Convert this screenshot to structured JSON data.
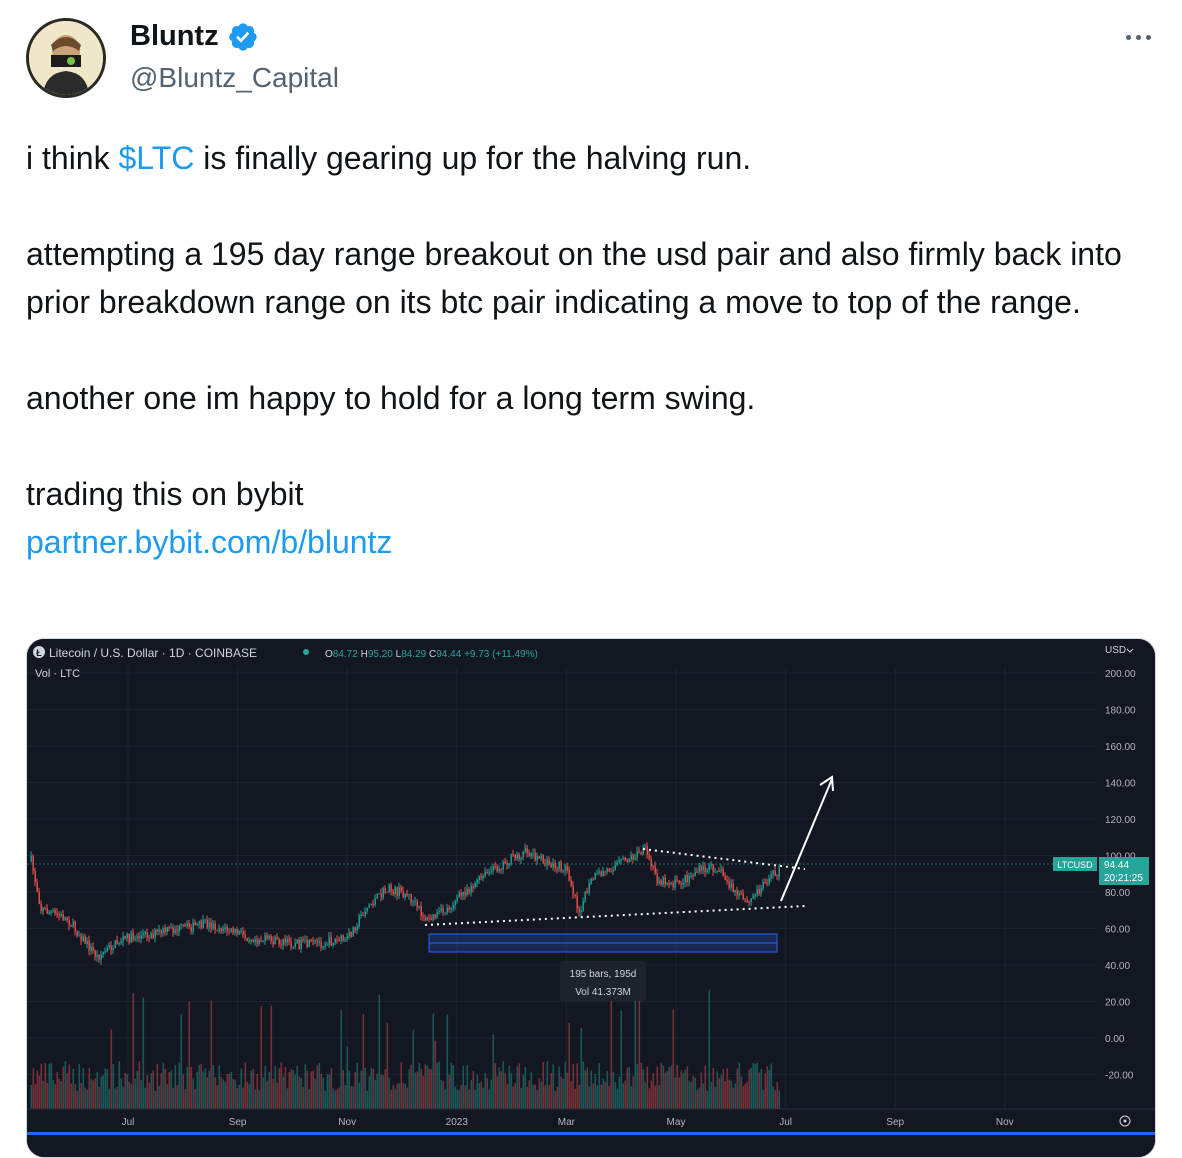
{
  "author": {
    "name": "Bluntz",
    "handle": "@Bluntz_Capital"
  },
  "tweet": {
    "line1_pre": "i think ",
    "cashtag": "$LTC",
    "line1_post": " is finally gearing up for the halving run.",
    "para2": "attempting a 195 day range breakout on the usd pair and also firmly back into prior breakdown range on its btc pair indicating a move to top of the range.",
    "para3": "another one im happy to hold for a long term swing.",
    "para4": "trading this on bybit",
    "link": "partner.bybit.com/b/bluntz"
  },
  "chart": {
    "symbol_title": "Litecoin / U.S. Dollar · 1D · COINBASE",
    "ohlc": {
      "o_label": "O",
      "o": "84.72",
      "h_label": "H",
      "h": "95.20",
      "l_label": "L",
      "l": "84.29",
      "c_label": "C",
      "c": "94.44",
      "change": "+9.73 (+11.49%)"
    },
    "vol_label": "Vol · LTC",
    "currency": "USD",
    "price_ticks": [
      "200.00",
      "180.00",
      "160.00",
      "140.00",
      "120.00",
      "100.00",
      "80.00",
      "60.00",
      "40.00",
      "20.00",
      "0.00",
      "-20.00"
    ],
    "time_ticks": [
      "Jul",
      "Sep",
      "Nov",
      "2023",
      "Mar",
      "May",
      "Jul",
      "Sep",
      "Nov"
    ],
    "price_tag_symbol": "LTCUSD",
    "price_tag_value": "94.44",
    "price_tag_countdown": "20:21:25",
    "range_label_bars": "195 bars, 195d",
    "range_label_vol": "Vol 41.373M",
    "colors": {
      "background": "#131722",
      "up": "#26a69a",
      "down": "#ef5350",
      "accent": "#1d9bf0",
      "tag": "#26a69a"
    }
  }
}
